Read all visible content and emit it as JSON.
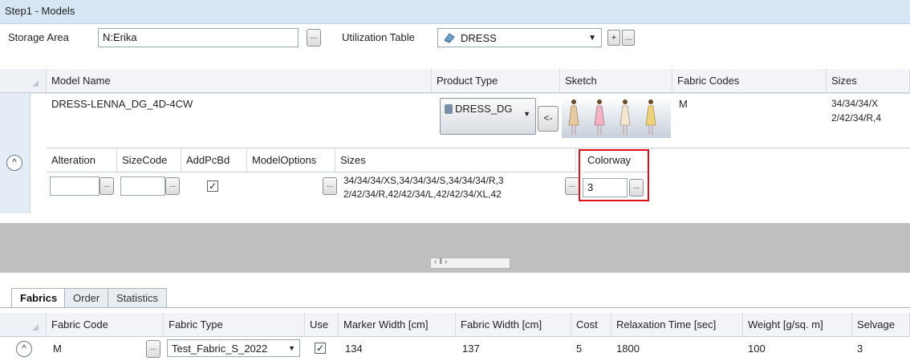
{
  "window": {
    "title": "Step1 - Models"
  },
  "top_bar": {
    "storage_area_label": "Storage Area",
    "storage_area_value": "N:Erika",
    "storage_area_btn": "...",
    "utilization_label": "Utilization Table",
    "utilization_value": "DRESS",
    "plus_btn": "+",
    "more_btn": "..."
  },
  "models_grid": {
    "columns": [
      "Model Name",
      "Product Type",
      "Sketch",
      "Fabric Codes",
      "Sizes"
    ],
    "row": {
      "model_name": "DRESS-LENNA_DG_4D-4CW",
      "product_type": "DRESS_DG",
      "product_type_btn": "<-",
      "fabric_codes": "M",
      "sizes_line1": "34/34/34/X",
      "sizes_line2": "2/42/34/R,4"
    }
  },
  "detail_grid": {
    "columns": [
      "Alteration",
      "SizeCode",
      "AddPcBd",
      "ModelOptions",
      "Sizes",
      "Colorway"
    ],
    "row": {
      "alteration": "",
      "sizecode": "",
      "addpcbd_checked": true,
      "sizes_line1": "34/34/34/XS,34/34/34/S,34/34/34/R,3",
      "sizes_line2": "2/42/34/R,42/42/34/L,42/42/34/XL,42",
      "colorway": "3"
    },
    "scrollbar_glyph": "‹  ‖  ›"
  },
  "tabs": {
    "items": [
      "Fabrics",
      "Order",
      "Statistics"
    ],
    "active": "Fabrics"
  },
  "fabrics_grid": {
    "columns": [
      "Fabric Code",
      "Fabric Type",
      "Use",
      "Marker Width [cm]",
      "Fabric Width [cm]",
      "Cost",
      "Relaxation Time [sec]",
      "Weight [g/sq. m]",
      "Selvage"
    ],
    "row": {
      "fabric_code": "M",
      "fabric_type": "Test_Fabric_S_2022",
      "use_checked": true,
      "marker_width": "134",
      "fabric_width": "137",
      "cost": "5",
      "relaxation_time": "1800",
      "weight": "100",
      "selvage": "3"
    }
  },
  "colors": {
    "accent": "#d6e6f5",
    "highlight": "#e0101a",
    "band": "#bfbfbf"
  }
}
